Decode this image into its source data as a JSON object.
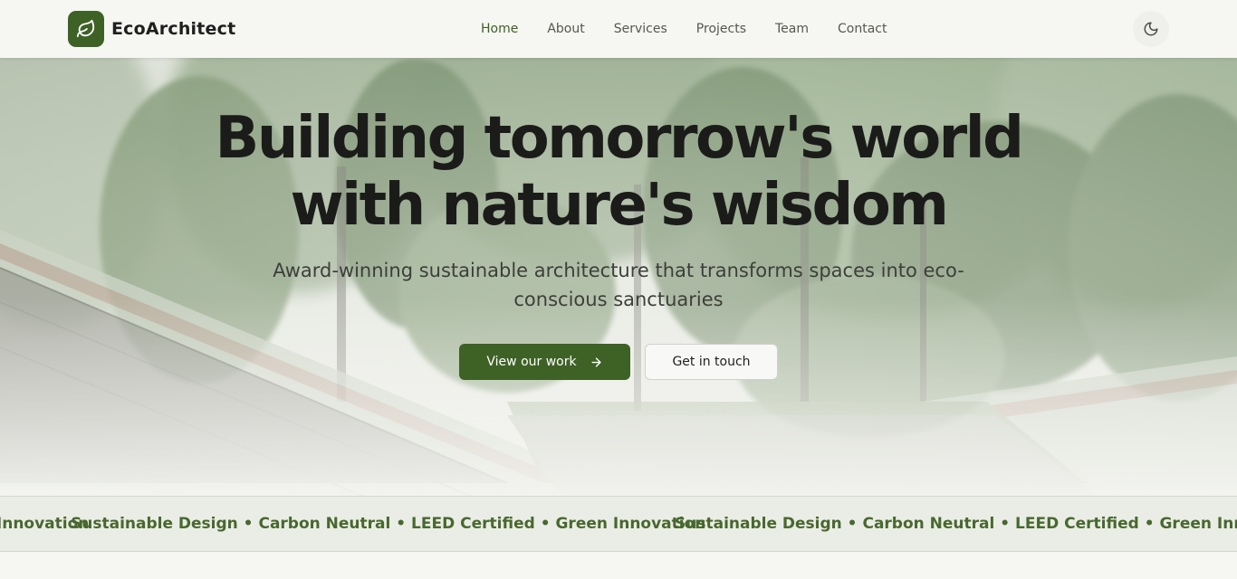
{
  "brand": {
    "name": "EcoArchitect",
    "logo_icon": "leaf-icon"
  },
  "nav": {
    "items": [
      {
        "label": "Home",
        "active": true
      },
      {
        "label": "About",
        "active": false
      },
      {
        "label": "Services",
        "active": false
      },
      {
        "label": "Projects",
        "active": false
      },
      {
        "label": "Team",
        "active": false
      },
      {
        "label": "Contact",
        "active": false
      }
    ],
    "theme_toggle_icon": "moon-icon"
  },
  "hero": {
    "title_line1": "Building tomorrow's world",
    "title_line2": "with nature's wisdom",
    "subtitle": "Award-winning sustainable architecture that transforms spaces into eco-conscious sanctuaries",
    "primary_cta": "View our work",
    "primary_cta_icon": "arrow-right-icon",
    "secondary_cta": "Get in touch"
  },
  "marquee": {
    "partial_text": "Sustainable Design • Carbon Neutral • LEED Certified • Green Innovation",
    "text": "Sustainable Design • Carbon Neutral • LEED Certified • Green Innovation"
  },
  "colors": {
    "accent": "#3e6126",
    "accent_text": "#48682f",
    "background": "#f6f6f3",
    "heading": "#1b1c1a"
  }
}
